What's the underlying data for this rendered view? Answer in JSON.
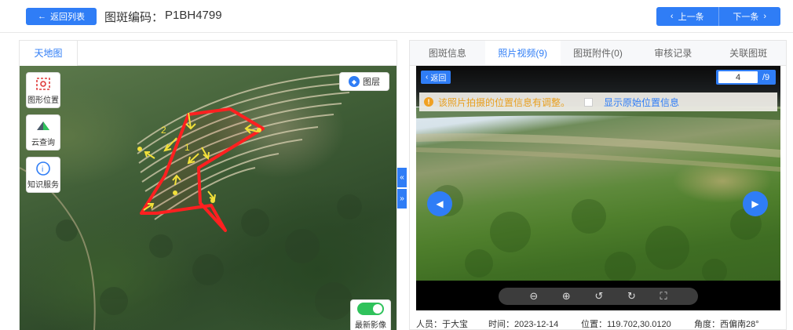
{
  "header": {
    "back_label": "返回列表",
    "title_label": "图斑编码：",
    "code": "P1BH4799",
    "prev_label": "上一条",
    "next_label": "下一条"
  },
  "map_panel": {
    "tab_label": "天地图",
    "tools": [
      {
        "label": "图形位置",
        "icon": "polygon-location-icon"
      },
      {
        "label": "云查询",
        "icon": "cloud-query-icon"
      },
      {
        "label": "知识服务",
        "icon": "knowledge-service-icon"
      }
    ],
    "layer_label": "图层",
    "latest_image_label": "最新影像",
    "latest_image_on": true,
    "markers": [
      "1",
      "2"
    ],
    "colors": {
      "polygon": "#ff2020",
      "arrow": "#f2e03a"
    }
  },
  "photo_panel": {
    "tabs": [
      {
        "label": "图斑信息",
        "active": false
      },
      {
        "label": "照片视频(9)",
        "active": true
      },
      {
        "label": "图斑附件(0)",
        "active": false
      },
      {
        "label": "审核记录",
        "active": false
      },
      {
        "label": "关联图斑",
        "active": false
      }
    ],
    "back_label": "返回",
    "current_page": "4",
    "total_pages": "/9",
    "notice_text": "该照片拍摄的位置信息有调整。",
    "show_original_label": "显示原始位置信息",
    "controls": [
      "zoom-out-icon",
      "zoom-in-icon",
      "rotate-left-icon",
      "rotate-right-icon",
      "fullscreen-icon"
    ],
    "footer": {
      "person": "人员：于大宝",
      "time": "时间：2023-12-14",
      "position": "位置：119.702,30.0120",
      "angle": "角度：西偏南28°"
    }
  },
  "colors": {
    "primary": "#2f7df6",
    "warning": "#f0a020",
    "toggle_on": "#2fc25b"
  }
}
